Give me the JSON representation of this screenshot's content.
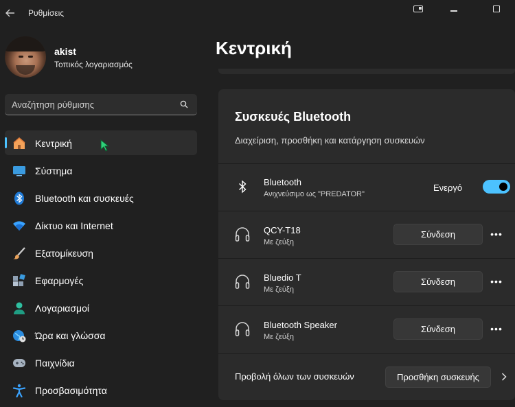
{
  "window": {
    "title": "Ρυθμίσεις"
  },
  "profile": {
    "name": "akist",
    "account_type": "Τοπικός λογαριασμός"
  },
  "search": {
    "placeholder": "Αναζήτηση ρύθμισης"
  },
  "nav": {
    "items": [
      {
        "label": "Κεντρική",
        "icon": "home-icon",
        "selected": true
      },
      {
        "label": "Σύστημα",
        "icon": "system-icon"
      },
      {
        "label": "Bluetooth και συσκευές",
        "icon": "bluetooth-icon"
      },
      {
        "label": "Δίκτυο και Internet",
        "icon": "network-icon"
      },
      {
        "label": "Εξατομίκευση",
        "icon": "brush-icon"
      },
      {
        "label": "Εφαρμογές",
        "icon": "apps-icon"
      },
      {
        "label": "Λογαριασμοί",
        "icon": "accounts-icon"
      },
      {
        "label": "Ώρα και γλώσσα",
        "icon": "time-language-icon"
      },
      {
        "label": "Παιχνίδια",
        "icon": "gamepad-icon"
      },
      {
        "label": "Προσβασιμότητα",
        "icon": "accessibility-icon"
      }
    ]
  },
  "main": {
    "title": "Κεντρική",
    "bluetooth_card": {
      "title": "Συσκευές Bluetooth",
      "description": "Διαχείριση, προσθήκη και κατάργηση συσκευών",
      "bluetooth": {
        "name": "Bluetooth",
        "status": "Ανιχνεύσιμο ως \"PREDATOR\"",
        "toggle_label": "Ενεργό",
        "enabled": true
      },
      "devices": [
        {
          "name": "QCY-T18",
          "status": "Με ζεύξη",
          "button": "Σύνδεση"
        },
        {
          "name": "Bluedio T",
          "status": "Με ζεύξη",
          "button": "Σύνδεση"
        },
        {
          "name": "Bluetooth Speaker",
          "status": "Με ζεύξη",
          "button": "Σύνδεση"
        }
      ],
      "footer": {
        "view_all": "Προβολή όλων των συσκευών",
        "add_button": "Προσθήκη συσκευής"
      }
    }
  },
  "colors": {
    "accent": "#4cc2ff",
    "background": "#202020",
    "card": "#2b2b2b"
  }
}
